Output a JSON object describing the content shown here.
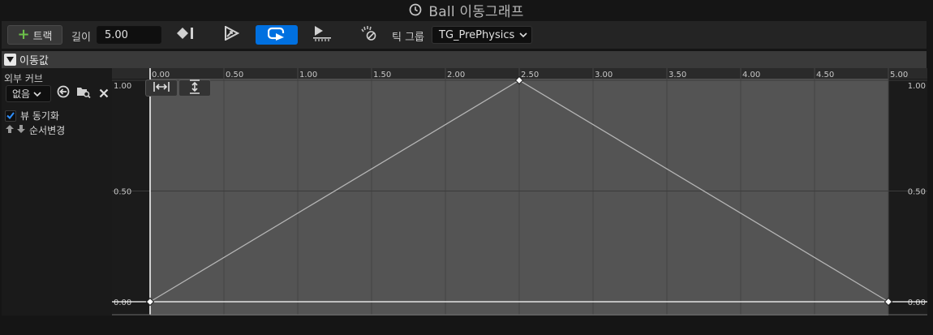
{
  "window": {
    "title": "Ball 이동그래프"
  },
  "toolbar": {
    "track_label": "트랙",
    "length_label": "길이",
    "length_value": "5.00",
    "tick_group_label": "틱 그룹",
    "tick_group_value": "TG_PrePhysics",
    "loop_active_color": "#0070e0"
  },
  "section": {
    "title": "이동값"
  },
  "side_panel": {
    "external_curve_label": "외부 커브",
    "external_curve_value": "없음",
    "sync_view_label": "뷰 동기화",
    "sync_view_checked": true,
    "reorder_label": "순서변경"
  },
  "chart_data": {
    "type": "line",
    "x_ticks": [
      "0.00",
      "0.50",
      "1.00",
      "1.50",
      "2.00",
      "2.50",
      "3.00",
      "3.50",
      "4.00",
      "4.50",
      "5.00"
    ],
    "y_ticks": [
      "1.00",
      "0.50",
      "0.00"
    ],
    "xlim": [
      0,
      5
    ],
    "ylim": [
      0,
      1
    ],
    "series": [
      {
        "x": [
          0,
          2.5,
          5
        ],
        "y": [
          0,
          1,
          0
        ]
      }
    ],
    "grid": true,
    "colors": {
      "curve": "#b5b5b5",
      "keyframe": "#ffffff",
      "plot_bg": "#545454",
      "outside_bg": "#1b1b1b"
    }
  }
}
